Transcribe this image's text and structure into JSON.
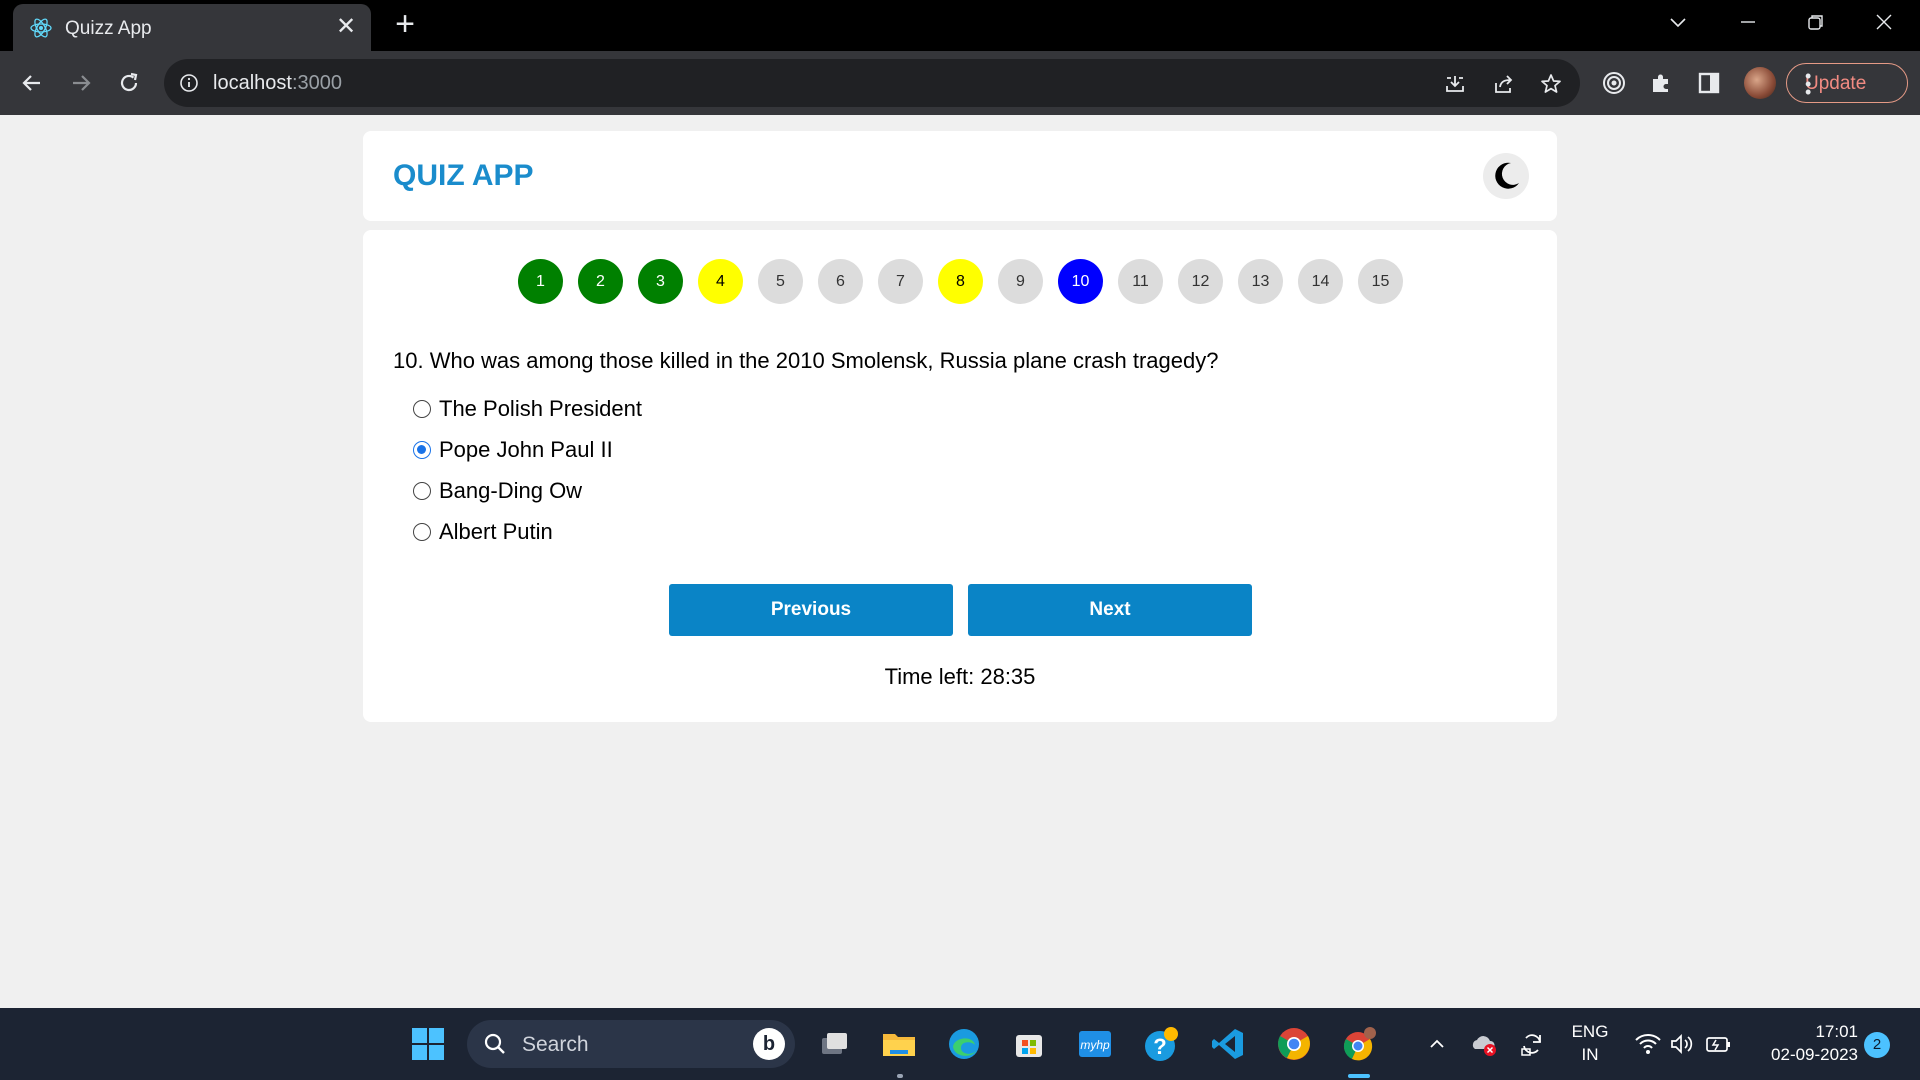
{
  "browser": {
    "tab_title": "Quizz App",
    "url_host": "localhost",
    "url_port": ":3000",
    "update_label": "Update"
  },
  "app": {
    "title": "QUIZ APP",
    "theme_icon": "moon-icon"
  },
  "question_nav": [
    {
      "label": "1",
      "status": "answered"
    },
    {
      "label": "2",
      "status": "answered"
    },
    {
      "label": "3",
      "status": "answered"
    },
    {
      "label": "4",
      "status": "review"
    },
    {
      "label": "5",
      "status": "unvisited"
    },
    {
      "label": "6",
      "status": "unvisited"
    },
    {
      "label": "7",
      "status": "unvisited"
    },
    {
      "label": "8",
      "status": "review"
    },
    {
      "label": "9",
      "status": "unvisited"
    },
    {
      "label": "10",
      "status": "current"
    },
    {
      "label": "11",
      "status": "unvisited"
    },
    {
      "label": "12",
      "status": "unvisited"
    },
    {
      "label": "13",
      "status": "unvisited"
    },
    {
      "label": "14",
      "status": "unvisited"
    },
    {
      "label": "15",
      "status": "unvisited"
    }
  ],
  "question": {
    "text": "10. Who was among those killed in the 2010 Smolensk, Russia plane crash tragedy?",
    "options": [
      {
        "label": "The Polish President",
        "selected": false
      },
      {
        "label": "Pope John Paul II",
        "selected": true
      },
      {
        "label": "Bang-Ding Ow",
        "selected": false
      },
      {
        "label": "Albert Putin",
        "selected": false
      }
    ]
  },
  "buttons": {
    "previous": "Previous",
    "next": "Next"
  },
  "timer": "Time left: 28:35",
  "colors": {
    "title": "#1a8ccc",
    "button": "#0a84c6",
    "answered": "#008000",
    "review": "#ffff00",
    "current": "#0000ff",
    "unvisited": "#dcdcdc"
  },
  "taskbar": {
    "search_label": "Search",
    "language": "ENG",
    "region": "IN",
    "time": "17:01",
    "date": "02-09-2023",
    "notifications": "2"
  }
}
